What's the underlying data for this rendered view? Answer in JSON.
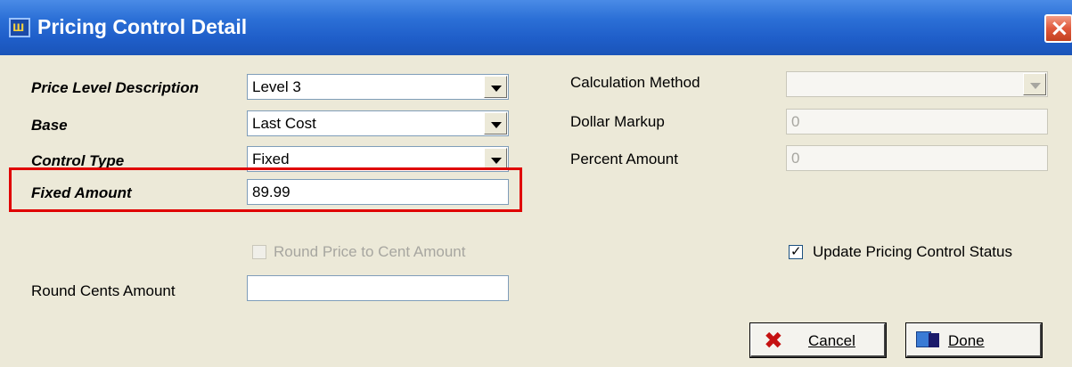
{
  "window": {
    "title": "Pricing Control Detail",
    "close_glyph": "×"
  },
  "left_panel": {
    "price_level_description": {
      "label": "Price Level Description",
      "value": "Level 3"
    },
    "base": {
      "label": "Base",
      "value": "Last Cost"
    },
    "control_type": {
      "label": "Control Type",
      "value": "Fixed"
    },
    "fixed_amount": {
      "label": "Fixed Amount",
      "value": "89.99"
    },
    "round_price_to_cent": {
      "label": "Round Price to Cent Amount",
      "checked": false,
      "enabled": false
    },
    "round_cents_amount": {
      "label": "Round Cents Amount",
      "value": ""
    }
  },
  "right_panel": {
    "calculation_method": {
      "label": "Calculation Method",
      "value": ""
    },
    "dollar_markup": {
      "label": "Dollar Markup",
      "value": "0"
    },
    "percent_amount": {
      "label": "Percent Amount",
      "value": "0"
    },
    "update_status": {
      "label": "Update Pricing Control Status",
      "checked": true
    }
  },
  "buttons": {
    "cancel": {
      "label": "Cancel",
      "icon": "red-x-icon"
    },
    "done": {
      "label": "Done",
      "icon": "exit-door-icon"
    }
  },
  "highlight_color": "#e00000",
  "check_glyph": "✓"
}
